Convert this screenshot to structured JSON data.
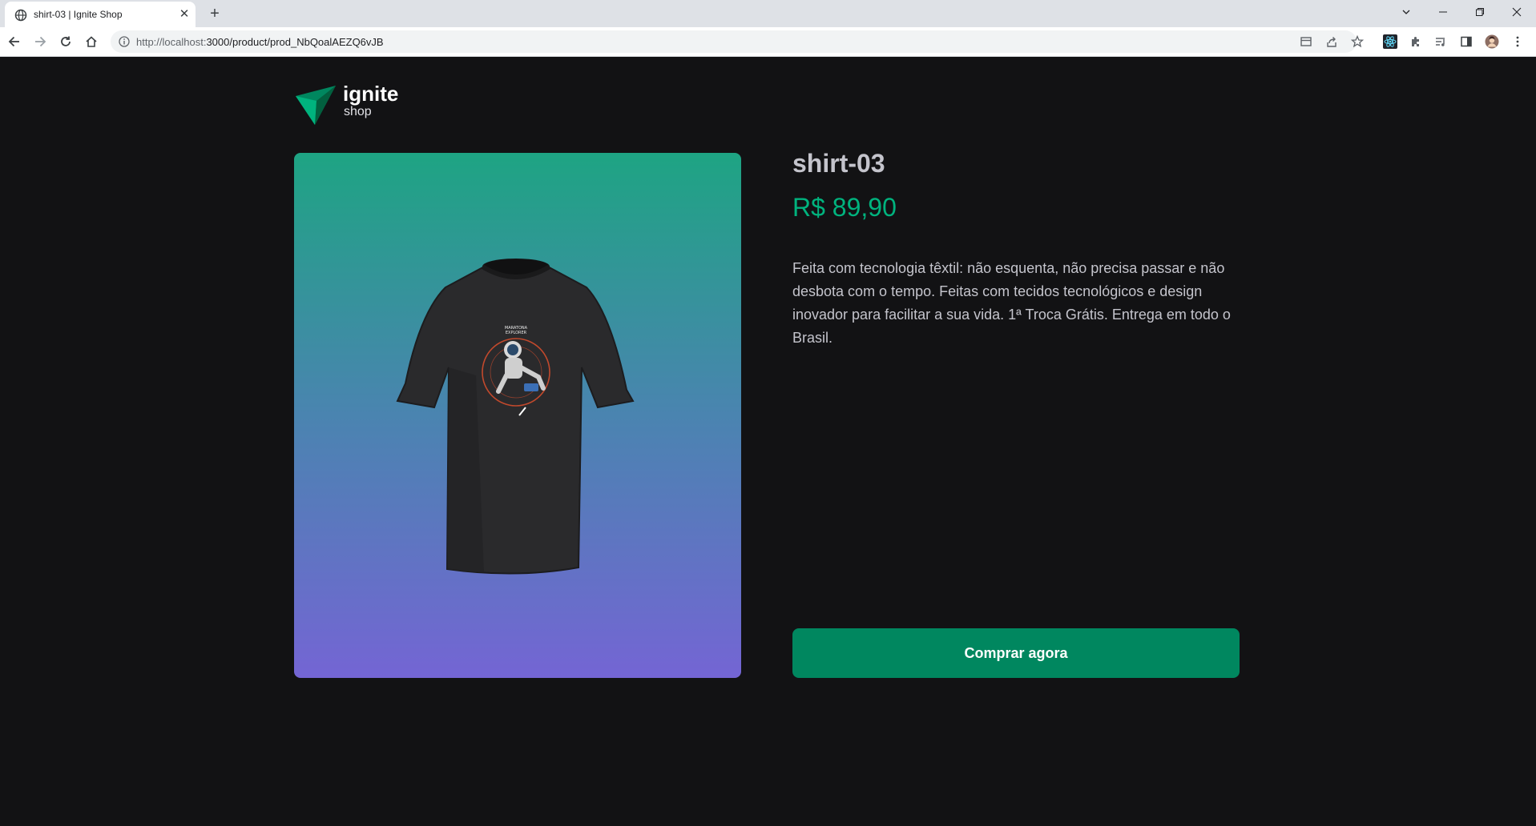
{
  "browser": {
    "tab_title": "shirt-03 | Ignite Shop",
    "url_host": "http://localhost:",
    "url_rest": "3000/product/prod_NbQoalAEZQ6vJB",
    "icons": [
      "globe-icon",
      "close-icon",
      "plus-icon",
      "chevron-down-icon",
      "minimize-icon",
      "restore-icon",
      "close-window-icon",
      "back-icon",
      "forward-icon",
      "reload-icon",
      "home-icon",
      "info-icon",
      "reader-mode-icon",
      "share-icon",
      "star-icon",
      "react-devtools-icon",
      "extensions-icon",
      "media-icon",
      "side-panel-icon",
      "profile-avatar-icon",
      "more-vert-icon"
    ]
  },
  "logo": {
    "title": "ignite",
    "subtitle": "shop"
  },
  "product": {
    "name": "shirt-03",
    "price": "R$ 89,90",
    "description": "Feita com tecnologia têxtil: não esquenta, não precisa passar e não desbota com o tempo. Feitas com tecidos tecnológicos e design inovador para facilitar a sua vida. 1ª Troca Grátis. Entrega em todo o Brasil.",
    "buy_label": "Comprar agora"
  },
  "colors": {
    "background": "#121214",
    "brand_green": "#00875f",
    "price_green": "#00b37e",
    "card_gradient_top": "#1ea483",
    "card_gradient_bottom": "#7465d4"
  }
}
